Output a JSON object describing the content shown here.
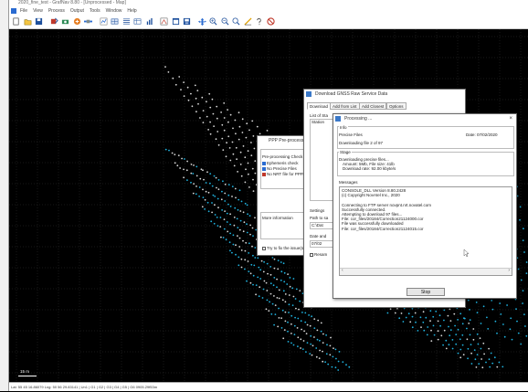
{
  "window": {
    "title": "2020_fine_test - GrafNav 8.80 - [Unprocessed - Map]"
  },
  "menu": [
    "File",
    "View",
    "Process",
    "Output",
    "Tools",
    "Window",
    "Help"
  ],
  "toolbar_icons": [
    "new-icon",
    "open-icon",
    "save-icon",
    "wizard-icon",
    "config-icon",
    "process-icon",
    "plot-icon",
    "map-icon",
    "zoom-in-icon",
    "zoom-out-icon",
    "help-icon",
    "stop-icon"
  ],
  "statusbar": {
    "text": "Lat: 55 45 16.86079  Lng: 50 56 29.83141  |  Un1  |  G1  |  G2  |  G3  |  G4  |  G5  |  G6  0905.29f53m"
  },
  "map": {
    "scale_label": "15 m"
  },
  "ppp": {
    "title": "PPP Pre-processing ...",
    "heading": "Pre-processing Check",
    "items": [
      {
        "label": "Ephemeris check",
        "color": "#2a6bd1"
      },
      {
        "label": "No Precise Files",
        "color": "#2a6bd1"
      },
      {
        "label": "No NRT file for PPP...",
        "color": "#c0392b"
      }
    ],
    "more_info": "More information",
    "try_fix": "Try to fix the issue(s)"
  },
  "download_dlg": {
    "title": "Download GNSS Raw Service Data",
    "tabs": [
      "Download",
      "Add from List",
      "Add Closest",
      "Options"
    ],
    "list_label": "List of Sta",
    "column": "Station",
    "settings_label": "Settings",
    "path_label": "Path to sa",
    "path_value": "C:\\Dat",
    "date_label": "Date and",
    "date_value": "07/02",
    "resample_label": "Resam"
  },
  "processing": {
    "title": "Processing ...",
    "info_label": "Info",
    "precise_label": "Precise Files",
    "date_text": "Date: 07/02/2020",
    "downloading_file": "Downloading file 2 of 97",
    "stage_label": "Stage",
    "stage_lines": [
      "Downloading precise files...",
      "Amount: 5Mb, File size: 41lb",
      "Download rate: 92.00 kbyte/s"
    ],
    "messages_label": "Messages",
    "messages": [
      "CONSOLE_DLL Version 8.80.2428",
      "(c) Copyright NovAtel Inc., 2020",
      "",
      "Connecting to FTP server novpnt.nrt.novatel.com",
      "Successfully connected.",
      "Attempting to download 97 files...",
      "File: cor_files/20184/Correction21124000.cor",
      "File was successfully downloaded",
      "File: cor_files/20184/Correction21124015.cor"
    ],
    "stop_label": "Stop"
  }
}
